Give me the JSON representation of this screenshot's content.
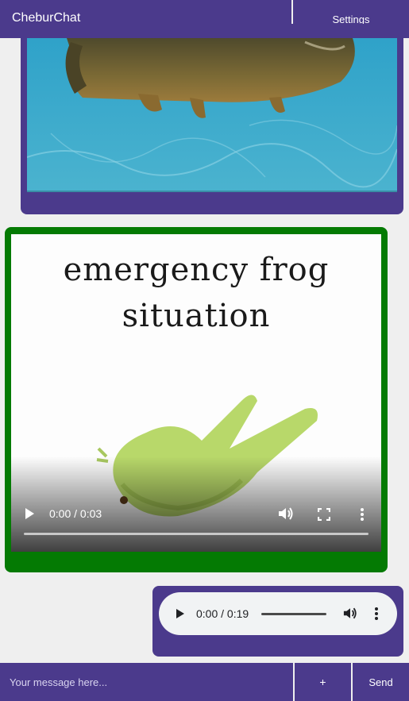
{
  "header": {
    "title": "CheburChat",
    "settings_label": "Settings"
  },
  "messages": {
    "frog_video": {
      "caption_line1": "emergency frog",
      "caption_line2": "situation",
      "time": "0:00 / 0:03",
      "progress": 0
    },
    "audio": {
      "time": "0:00 / 0:19",
      "progress": 0
    }
  },
  "composer": {
    "placeholder": "Your message here...",
    "add_label": "+",
    "send_label": "Send"
  },
  "colors": {
    "brand": "#4b3a8c",
    "frog_bubble": "#047a03",
    "background": "#efefef"
  },
  "icons": {
    "play": "play-icon",
    "volume": "volume-icon",
    "fullscreen": "fullscreen-icon",
    "more": "more-vert-icon"
  }
}
